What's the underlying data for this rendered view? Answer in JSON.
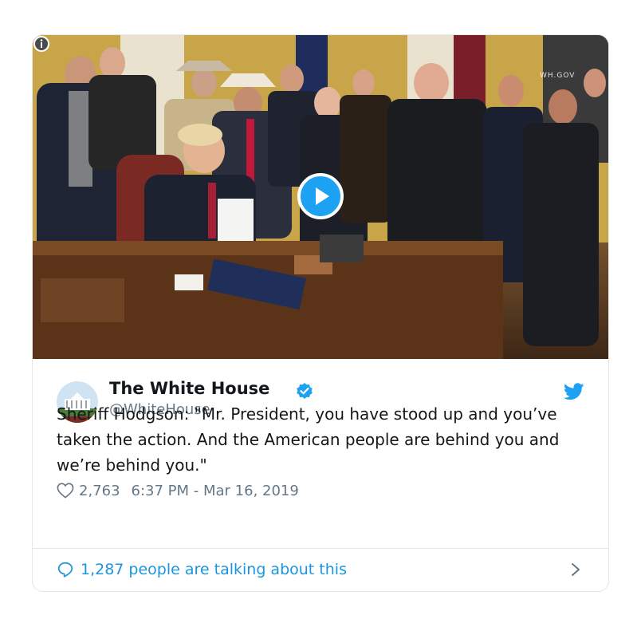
{
  "media": {
    "type": "video",
    "watermark": "WH.GOV",
    "play_icon": "play-icon",
    "info_icon": "info-icon"
  },
  "author": {
    "display_name": "The White House",
    "handle": "@WhiteHouse",
    "verified": true,
    "verified_icon": "verified-badge-icon",
    "avatar": "white-house-avatar"
  },
  "tweet": {
    "text": "Sheriff Hodgson: \"Mr. President, you have stood up and you’ve taken the action. And the American people are behind you and we’re behind you.\"",
    "likes": "2,763",
    "timestamp": "6:37 PM - Mar 16, 2019"
  },
  "footer": {
    "talking_label": "1,287 people are talking about this"
  },
  "colors": {
    "accent": "#1da1f2",
    "link": "#1b95e0",
    "secondary_text": "#657786",
    "border": "#e1e8ed"
  },
  "icons": [
    "info-icon",
    "play-icon",
    "verified-badge-icon",
    "twitter-bird-icon",
    "heart-icon",
    "comment-icon",
    "chevron-right-icon"
  ]
}
